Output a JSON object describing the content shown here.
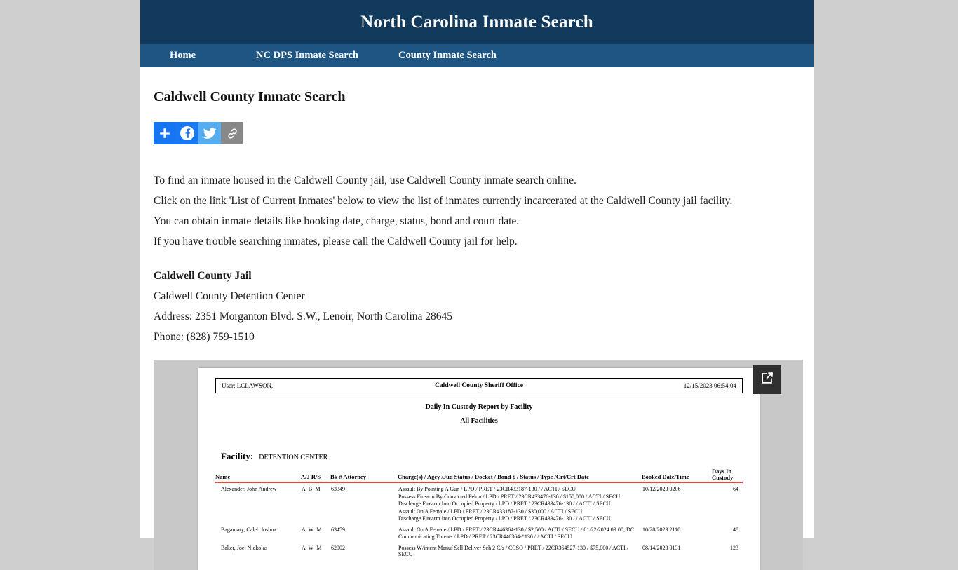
{
  "site": {
    "title": "North Carolina Inmate Search",
    "nav": [
      {
        "label": "Home"
      },
      {
        "label": "NC DPS Inmate Search"
      },
      {
        "label": "County Inmate Search"
      }
    ]
  },
  "page": {
    "title": "Caldwell County Inmate Search",
    "share": [
      {
        "name": "share-plus-button",
        "label": "Share"
      },
      {
        "name": "share-facebook-button",
        "label": "Facebook"
      },
      {
        "name": "share-twitter-button",
        "label": "Twitter"
      },
      {
        "name": "share-link-button",
        "label": "Copy Link"
      }
    ],
    "intro": [
      "To find an inmate housed in the Caldwell County jail, use Caldwell County inmate search online.",
      "Click on the link 'List of Current Inmates' below to view the list of inmates currently incarcerated at the Caldwell County jail facility.",
      "You can obtain inmate details like booking date, charge, status, bond and court date.",
      "If you have trouble searching inmates, please call the Caldwell County jail for help."
    ],
    "jail": {
      "heading": "Caldwell County Jail",
      "facility": "Caldwell County Detention Center",
      "address": "Address: 2351 Morganton Blvd. S.W., Lenoir, North Carolina 28645",
      "phone": "Phone: (828) 759-1510"
    }
  },
  "pdf": {
    "popout_label": "Open in new window",
    "header": {
      "user": "User: LCLAWSON,",
      "office": "Caldwell County Sheriff Office",
      "timestamp": "12/15/2023 06:54:04"
    },
    "report_title": "Daily In Custody Report by Facility",
    "report_scope": "All Facilities",
    "facility_label": "Facility:",
    "facility_value": "DETENTION CENTER",
    "columns": {
      "name": "Name",
      "ajrs": "A/J R/S",
      "bk": "Bk # Attorney",
      "charges": "Charge(s) / Agcy /Jud Status / Docket / Bond $ / Status / Type /Crt/Crt Date",
      "booked": "Booked Date/Time",
      "days_line1": "Days In",
      "days_line2": "Custody"
    },
    "rows": [
      {
        "name": "Alexander, John Andrew",
        "ajrs": "A  B M",
        "bk": "63349",
        "charges": [
          "Assault By Pointing A Gun / LPD / PRET / 23CR433187-130 /  /  ACTI / SECU",
          "Possess Firearm By Convicted Felon / LPD / PRET / 23CR433476-130 / $150,000 / ACTI / SECU",
          "Discharge Firearm Into Occupied Property / LPD / PRET / 23CR433476-130 /  / ACTI / SECU",
          "Assault On A Female / LPD / PRET / 23CR433187-130 / $30,000 / ACTI / SECU",
          "Discharge Firearm Into Occupied Property / LPD / PRET / 23CR433476-130 /  / ACTI / SECU"
        ],
        "booked": "10/12/2023   0206",
        "days": "64"
      },
      {
        "name": "Bagamary, Caleb Joshua",
        "ajrs": "A  W M",
        "bk": "63459",
        "charges": [
          "Assault On A Female / LPD / PRET / 23CR446364-130 / $2,500 / ACTI / SECU / 01/22/2024 09:00, DC",
          "Communicating Threats / LPD / PRET / 23CR446364-*130 /  / ACTI / SECU"
        ],
        "booked": "10/28/2023   2110",
        "days": "48"
      },
      {
        "name": "Baker, Joel Nickolas",
        "ajrs": "A  W M",
        "bk": "62902",
        "charges": [
          "Possess W/intent Manuf Sell Deliver Sch 2 C/s / CCSO / PRET / 22CR364527-130 / $75,000 / ACTI / SECU"
        ],
        "booked": "08/14/2023   0131",
        "days": "123"
      }
    ]
  }
}
